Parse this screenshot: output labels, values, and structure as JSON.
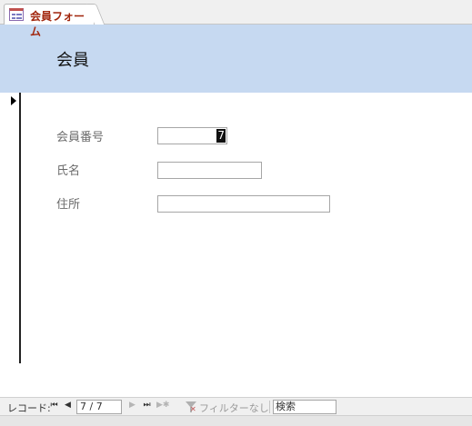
{
  "tab": {
    "label": "会員フォーム",
    "icon": "form-icon"
  },
  "header": {
    "title": "会員"
  },
  "fields": [
    {
      "label": "会員番号",
      "value": "7"
    },
    {
      "label": "氏名",
      "value": ""
    },
    {
      "label": "住所",
      "value": ""
    }
  ],
  "nav": {
    "record_label": "レコード:",
    "position": "7 / 7",
    "filter_label": "フィルターなし",
    "search_placeholder": "検索"
  },
  "colors": {
    "header_bg": "#c6d9f1",
    "tab_text": "#a1260d"
  }
}
